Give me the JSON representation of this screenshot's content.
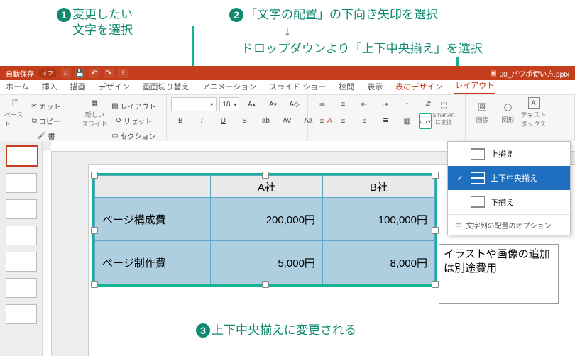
{
  "callouts": {
    "c1": "変更したい\n文字を選択",
    "c2": "「文字の配置」の下向き矢印を選択",
    "c2b": "ドロップダウンより「上下中央揃え」を選択",
    "c3": "上下中央揃えに変更される"
  },
  "titlebar": {
    "autosave": "自動保存",
    "autosave_state": "オフ",
    "filename": "00_パワポ使い方.pptx"
  },
  "tabs": [
    "ホーム",
    "挿入",
    "描画",
    "デザイン",
    "画面切り替え",
    "アニメーション",
    "スライド ショー",
    "校閲",
    "表示",
    "表のデザイン",
    "レイアウト"
  ],
  "ribbon": {
    "clipboard": {
      "paste": "ペースト",
      "cut": "カット",
      "copy": "コピー",
      "fmt": "書"
    },
    "slides": {
      "new": "新しい\nスライド",
      "layout": "レイアウト",
      "reset": "リセット",
      "section": "セクション"
    },
    "font": {
      "family": "",
      "size": "18",
      "buttons": [
        "B",
        "I",
        "U",
        "S",
        "ab",
        "AV",
        "Aa",
        "A"
      ]
    },
    "para_icons": [
      "list-ul",
      "list-ol",
      "indent-dec",
      "indent-inc",
      "line-spacing",
      "text-direction",
      "align-left",
      "align-center",
      "align-right",
      "align-justify",
      "columns",
      "valign"
    ],
    "convert": "SmartArt\nに変換",
    "insert": {
      "image": "画像",
      "shape": "図形",
      "textbox": "テキスト\nボックス"
    }
  },
  "valign_menu": {
    "top": "上揃え",
    "middle": "上下中央揃え",
    "bottom": "下揃え",
    "more": "文字列の配置のオプション..."
  },
  "table": {
    "headers": [
      "",
      "A社",
      "B社"
    ],
    "rows": [
      {
        "label": "ページ構成費",
        "a": "200,000円",
        "b": "100,000円"
      },
      {
        "label": "ページ制作費",
        "a": "5,000円",
        "b": "8,000円"
      }
    ]
  },
  "sidebox": "イラストや画像の追加は別途費用"
}
